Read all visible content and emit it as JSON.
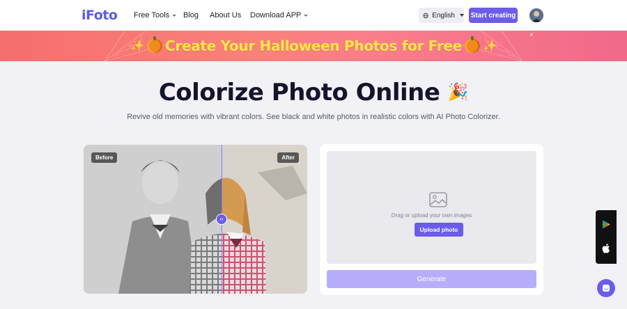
{
  "nav": {
    "logo": "iFoto",
    "items": [
      {
        "label": "Free Tools",
        "has_caret": true
      },
      {
        "label": "Blog",
        "has_caret": false
      },
      {
        "label": "About Us",
        "has_caret": false
      },
      {
        "label": "Download APP",
        "has_caret": true
      }
    ],
    "language": "English",
    "cta": "Start creating",
    "icons": {
      "language": "globe-icon",
      "avatar": "user-avatar"
    }
  },
  "banner": {
    "text": "Create Your Halloween Photos for Free",
    "close": "×",
    "colors": {
      "text": "#ffe74a",
      "start": "#f76e6e",
      "end": "#f06a8a"
    }
  },
  "hero": {
    "title": "Colorize Photo Online",
    "title_emoji": "🎉",
    "subtitle": "Revive old memories with vibrant colors. See black and white photos in realistic colors with AI Photo Colorizer."
  },
  "compare": {
    "before_label": "Before",
    "after_label": "After",
    "handle_icon": "arrows-left-right-icon"
  },
  "upload": {
    "hint": "Drag or upload your own images",
    "button": "Upload photo",
    "generate": "Generate",
    "icon": "image-icon"
  },
  "side": {
    "icons": [
      "google-play-icon",
      "apple-icon",
      "chat-icon"
    ]
  },
  "colors": {
    "accent": "#6c5ce7",
    "accent_light": "#b7aefb",
    "bg": "#f1f1f6"
  }
}
